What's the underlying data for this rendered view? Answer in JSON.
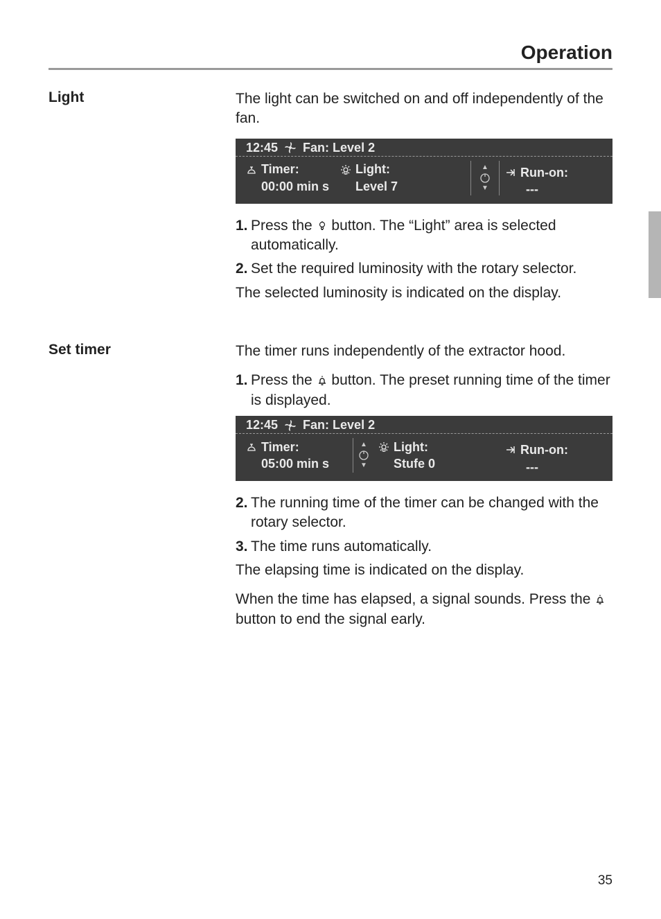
{
  "header": {
    "title": "Operation"
  },
  "sections": {
    "light": {
      "label": "Light",
      "intro": "The light can be switched on and off independently of the fan.",
      "display": {
        "time": "12:45",
        "fan_label": "Fan: Level 2",
        "timer_label": "Timer:",
        "timer_value": "00:00 min s",
        "light_label": "Light:",
        "light_value": "Level 7",
        "runon_label": "Run-on:",
        "runon_value": "---"
      },
      "step1_num": "1.",
      "step1_a": "Press the ",
      "step1_b": " button. The “Light” area is selected automatically.",
      "step2_num": "2.",
      "step2": "Set the required luminosity with the rotary selector.",
      "outro": "The selected luminosity is indicated on the display."
    },
    "timer": {
      "label": "Set timer",
      "intro": "The timer runs independently of the extractor hood.",
      "step1_num": "1.",
      "step1_a": "Press the ",
      "step1_b": " button. The preset running time of the timer is displayed.",
      "display": {
        "time": "12:45",
        "fan_label": "Fan: Level 2",
        "timer_label": "Timer:",
        "timer_value": "05:00 min s",
        "light_label": "Light:",
        "light_value": "Stufe 0",
        "runon_label": "Run-on:",
        "runon_value": "---"
      },
      "step2_num": "2.",
      "step2": "The running time of the timer can be changed with the rotary selector.",
      "step3_num": "3.",
      "step3": "The time runs automatically.",
      "outro1": "The elapsing time is indicated on the display.",
      "outro2_a": "When the time has elapsed, a signal sounds. Press the ",
      "outro2_b": " button to end the signal early."
    }
  },
  "page_number": "35"
}
